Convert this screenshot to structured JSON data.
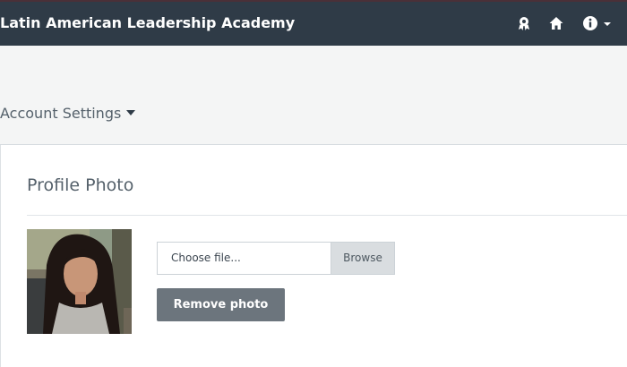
{
  "header": {
    "title": "Latin American Leadership Academy",
    "icons": [
      "award-icon",
      "home-icon",
      "info-icon",
      "chevron-down-icon"
    ],
    "background": "#2f3b47"
  },
  "subheader": {
    "account_settings_label": "Account Settings"
  },
  "profile": {
    "section_title": "Profile Photo",
    "file_placeholder": "Choose file...",
    "browse_label": "Browse",
    "remove_label": "Remove photo",
    "remove_button_color": "#6c757d"
  }
}
